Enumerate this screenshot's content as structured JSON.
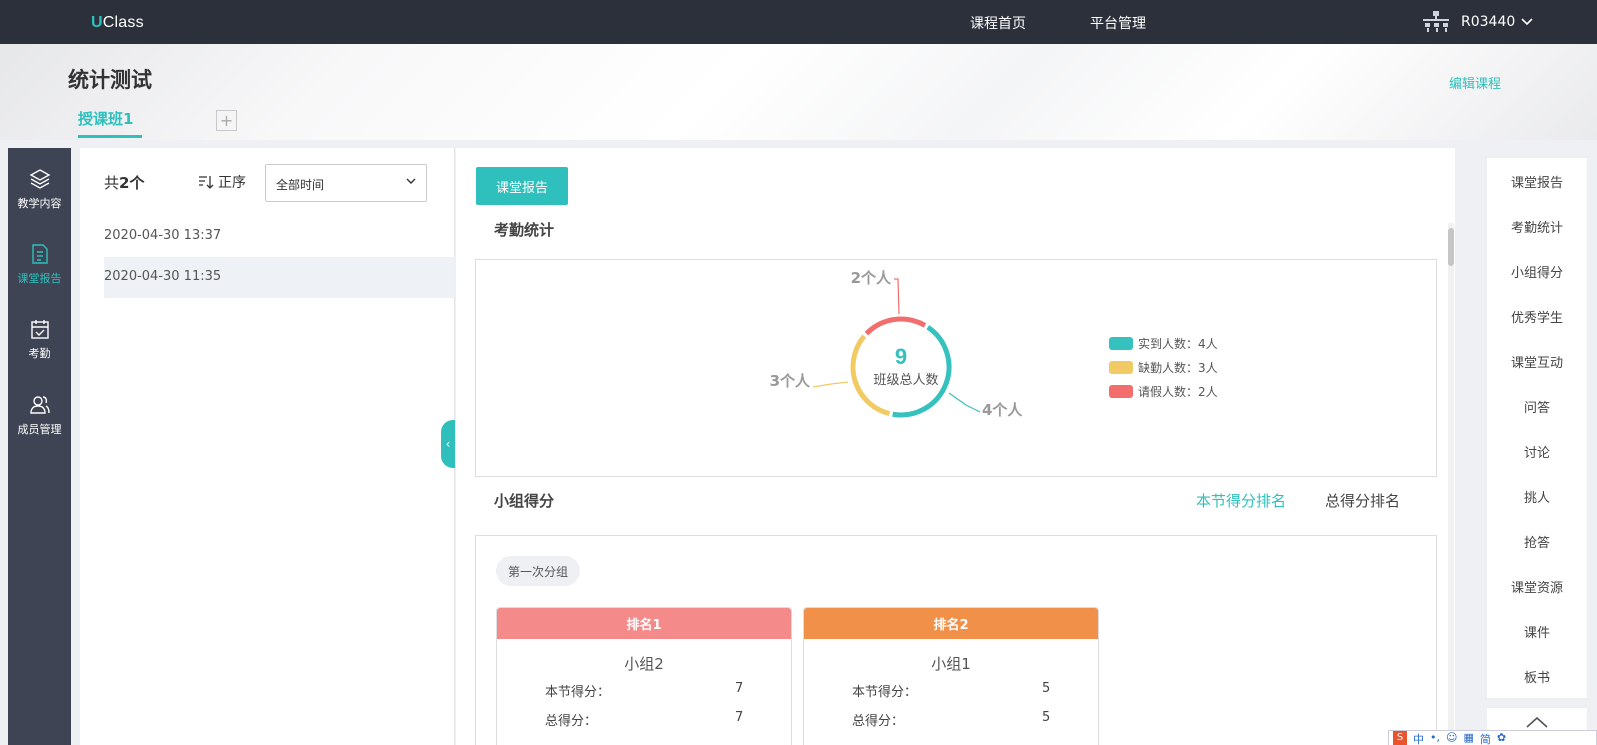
{
  "topbar": {
    "logo_u": "U",
    "logo_rest": "Class",
    "nav": [
      {
        "label": "课程首页"
      },
      {
        "label": "平台管理"
      }
    ],
    "user": "R03440"
  },
  "header": {
    "course_title": "统计测试",
    "edit_course": "编辑课程",
    "class_tab": "授课班1",
    "add_tab": "+"
  },
  "sidebar": {
    "items": [
      {
        "label": "教学内容",
        "icon": "layers-icon",
        "active": false
      },
      {
        "label": "课堂报告",
        "icon": "document-icon",
        "active": true
      },
      {
        "label": "考勤",
        "icon": "calendar-check-icon",
        "active": false
      },
      {
        "label": "成员管理",
        "icon": "users-icon",
        "active": false
      }
    ]
  },
  "records": {
    "count_prefix": "共",
    "count": "2个",
    "sort_label": "正序",
    "time_filter": "全部时间",
    "items": [
      {
        "time": "2020-04-30 13:37",
        "selected": false
      },
      {
        "time": "2020-04-30 11:35",
        "selected": true
      }
    ]
  },
  "main": {
    "report_button": "课堂报告",
    "attendance_title": "考勤统计",
    "group_title": "小组得分",
    "score_tabs": [
      {
        "label": "本节得分排名",
        "active": true
      },
      {
        "label": "总得分排名",
        "active": false
      }
    ],
    "group_pill": "第一次分组",
    "ranks": [
      {
        "rank": "排名1",
        "group": "小组2",
        "session_label": "本节得分：",
        "session_score": "7",
        "total_label": "总得分：",
        "total_score": "7",
        "color": "#f58a8a"
      },
      {
        "rank": "排名2",
        "group": "小组1",
        "session_label": "本节得分：",
        "session_score": "5",
        "total_label": "总得分：",
        "total_score": "5",
        "color": "#f19149"
      }
    ]
  },
  "chart_data": {
    "type": "pie",
    "center_value": "9",
    "center_label": "班级总人数",
    "slices": [
      {
        "name": "实到人数",
        "value": 4,
        "label": "4个人",
        "legend": "实到人数：4人",
        "color": "#35c1bd"
      },
      {
        "name": "缺勤人数",
        "value": 3,
        "label": "3个人",
        "legend": "缺勤人数：3人",
        "color": "#f2ca63"
      },
      {
        "name": "请假人数",
        "value": 2,
        "label": "2个人",
        "legend": "请假人数：2人",
        "color": "#f46d6d"
      }
    ],
    "legend_position": "right"
  },
  "right_nav": {
    "items": [
      "课堂报告",
      "考勤统计",
      "小组得分",
      "优秀学生",
      "课堂互动",
      "问答",
      "讨论",
      "挑人",
      "抢答",
      "课堂资源",
      "课件",
      "板书"
    ]
  },
  "ime": {
    "items": [
      "中",
      "简"
    ]
  }
}
